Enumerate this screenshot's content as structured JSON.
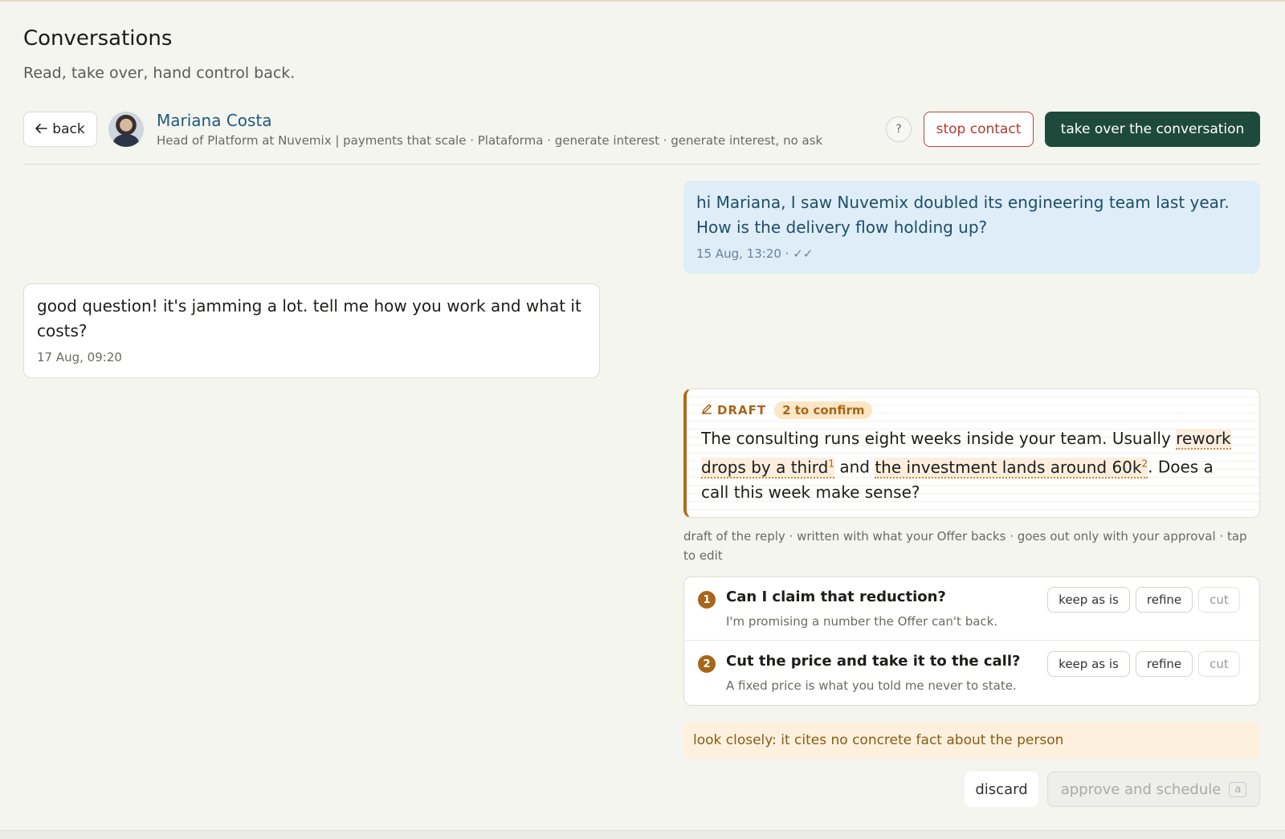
{
  "page": {
    "title": "Conversations",
    "subtitle": "Read, take over, hand control back."
  },
  "header": {
    "back_label": "back",
    "contact_name": "Mariana Costa",
    "contact_meta": "Head of Platform at Nuvemix | payments that scale · Plataforma · generate interest · generate interest, no ask",
    "help_label": "?",
    "stop_label": "stop contact",
    "takeover_label": "take over the conversation"
  },
  "messages": [
    {
      "direction": "outgoing",
      "text": "hi Mariana, I saw Nuvemix doubled its engineering team last year. How is the delivery flow holding up?",
      "time": "15 Aug, 13:20 · ✓✓"
    },
    {
      "direction": "incoming",
      "text": "good question! it's jamming a lot. tell me how you work and what it costs?",
      "time": "17 Aug, 09:20"
    }
  ],
  "draft": {
    "label": "DRAFT",
    "badge": "2 to confirm",
    "text_part1": "The consulting runs eight weeks inside your team. Usually ",
    "claim1": "rework drops by a third",
    "claim1_sup": "1",
    "text_part2": " and ",
    "claim2": "the investment lands around 60k",
    "claim2_sup": "2",
    "text_part3": ". Does a call this week make sense?",
    "note": "draft of the reply · written with what your Offer backs · goes out only with your approval · tap to edit"
  },
  "claims": [
    {
      "number": "1",
      "question": "Can I claim that reduction?",
      "detail": "I'm promising a number the Offer can't back.",
      "keep_label": "keep as is",
      "refine_label": "refine",
      "cut_label": "cut"
    },
    {
      "number": "2",
      "question": "Cut the price and take it to the call?",
      "detail": "A fixed price is what you told me never to state.",
      "keep_label": "keep as is",
      "refine_label": "refine",
      "cut_label": "cut"
    }
  ],
  "warning": "look closely: it cites no concrete fact about the person",
  "actions": {
    "discard_label": "discard",
    "approve_label": "approve and schedule",
    "approve_shortcut": "a"
  },
  "colors": {
    "accent_dark_green": "#1e4a3c",
    "draft_accent": "#b36b12",
    "outgoing_bubble": "#deedf8",
    "stop_red": "#b23a2e"
  },
  "icons": {
    "back": "arrow-left-icon",
    "draft": "pencil-icon"
  }
}
